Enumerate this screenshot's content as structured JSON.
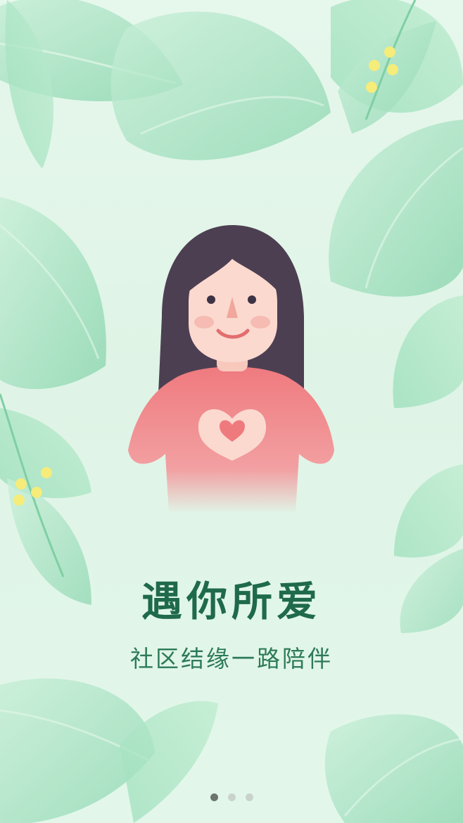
{
  "onboarding": {
    "title": "遇你所爱",
    "subtitle": "社区结缘一路陪伴",
    "page_indicator": {
      "total": 3,
      "active_index": 0
    }
  },
  "theme": {
    "title_color": "#1f6a4a",
    "subtitle_color": "#2d7a58",
    "leaf_color": "#a9e2c4",
    "berry_color": "#f5ec7a",
    "sweater_color": "#ef7a7e",
    "hair_color": "#4d3f52"
  },
  "icons": {
    "illustration": "girl-heart-hands-illustration",
    "background": "tropical-leaves"
  }
}
